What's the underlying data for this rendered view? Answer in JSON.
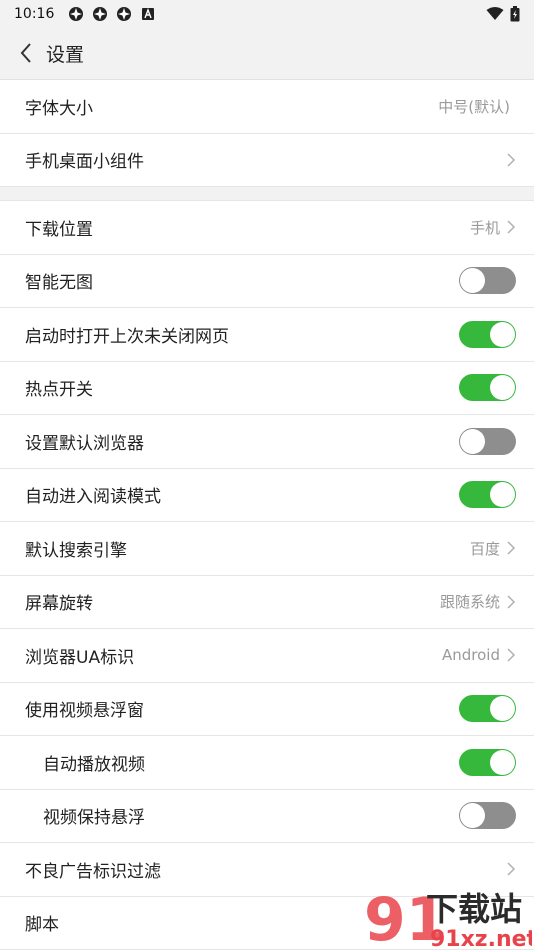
{
  "status_bar": {
    "time": "10:16",
    "left_icons": [
      "app-icon",
      "app-icon",
      "app-icon",
      "a-icon"
    ],
    "right_icons": [
      "wifi-icon",
      "battery-icon"
    ]
  },
  "header": {
    "title": "设置",
    "back_icon": "chevron-left-icon"
  },
  "rows": {
    "font_size": {
      "label": "字体大小",
      "value": "中号(默认)"
    },
    "widget": {
      "label": "手机桌面小组件"
    },
    "download": {
      "label": "下载位置",
      "value": "手机"
    },
    "no_image": {
      "label": "智能无图",
      "enabled": false
    },
    "restore": {
      "label": "启动时打开上次未关闭网页",
      "enabled": true
    },
    "hotspot": {
      "label": "热点开关",
      "enabled": true
    },
    "default_browser": {
      "label": "设置默认浏览器",
      "enabled": false
    },
    "reader": {
      "label": "自动进入阅读模式",
      "enabled": true
    },
    "search_engine": {
      "label": "默认搜索引擎",
      "value": "百度"
    },
    "rotation": {
      "label": "屏幕旋转",
      "value": "跟随系统"
    },
    "ua": {
      "label": "浏览器UA标识",
      "value": "Android"
    },
    "video_float": {
      "label": "使用视频悬浮窗",
      "enabled": true
    },
    "autoplay": {
      "label": "自动播放视频",
      "enabled": true
    },
    "keep_float": {
      "label": "视频保持悬浮",
      "enabled": false
    },
    "ad_filter": {
      "label": "不良广告标识过滤"
    },
    "script": {
      "label": "脚本"
    }
  },
  "watermark": {
    "logo_text": "下载站",
    "domain": "91xz.net",
    "numeral": "91"
  },
  "colors": {
    "toggle_on": "#36b83d",
    "toggle_off": "#8e8e8e",
    "value_gray": "#9a9a9a",
    "background": "#f2f2f2"
  }
}
